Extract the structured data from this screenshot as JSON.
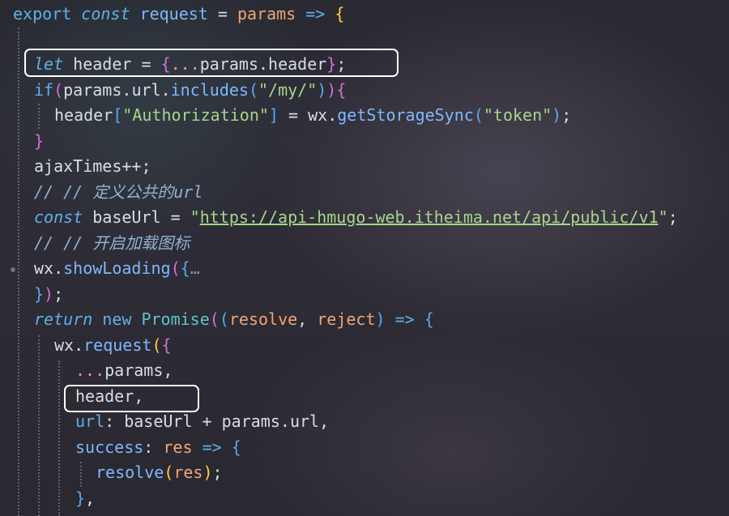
{
  "editor": {
    "lines": [
      {
        "tokens": [
          {
            "t": "export ",
            "c": "kw"
          },
          {
            "t": "const ",
            "c": "kwi"
          },
          {
            "t": "request ",
            "c": "fn"
          },
          {
            "t": "= ",
            "c": "pun"
          },
          {
            "t": "params ",
            "c": "param"
          },
          {
            "t": "=> ",
            "c": "kw"
          },
          {
            "t": "{",
            "c": "b1"
          }
        ]
      },
      {
        "tokens": []
      },
      {
        "tokens": [
          {
            "t": "let ",
            "c": "kwi"
          },
          {
            "t": "header ",
            "c": "prop"
          },
          {
            "t": "= ",
            "c": "pun"
          },
          {
            "t": "{",
            "c": "b2"
          },
          {
            "t": "...",
            "c": "op"
          },
          {
            "t": "params",
            "c": "prop"
          },
          {
            "t": ".",
            "c": "pun"
          },
          {
            "t": "header",
            "c": "prop"
          },
          {
            "t": "}",
            "c": "b2"
          },
          {
            "t": ";",
            "c": "pun"
          }
        ]
      },
      {
        "tokens": [
          {
            "t": "if",
            "c": "kw"
          },
          {
            "t": "(",
            "c": "b2"
          },
          {
            "t": "params",
            "c": "prop"
          },
          {
            "t": ".",
            "c": "pun"
          },
          {
            "t": "url",
            "c": "prop"
          },
          {
            "t": ".",
            "c": "pun"
          },
          {
            "t": "includes",
            "c": "fn"
          },
          {
            "t": "(",
            "c": "b3"
          },
          {
            "t": "\"/my/\"",
            "c": "str"
          },
          {
            "t": ")",
            "c": "b3"
          },
          {
            "t": ")",
            "c": "b2"
          },
          {
            "t": "{",
            "c": "b2"
          }
        ]
      },
      {
        "tokens": [
          {
            "t": "header",
            "c": "prop"
          },
          {
            "t": "[",
            "c": "b3"
          },
          {
            "t": "\"Authorization\"",
            "c": "str"
          },
          {
            "t": "]",
            "c": "b3"
          },
          {
            "t": " = ",
            "c": "pun"
          },
          {
            "t": "wx",
            "c": "prop"
          },
          {
            "t": ".",
            "c": "pun"
          },
          {
            "t": "getStorageSync",
            "c": "fn"
          },
          {
            "t": "(",
            "c": "b3"
          },
          {
            "t": "\"token\"",
            "c": "str"
          },
          {
            "t": ")",
            "c": "b3"
          },
          {
            "t": ";",
            "c": "pun"
          }
        ]
      },
      {
        "tokens": [
          {
            "t": "}",
            "c": "b2"
          }
        ]
      },
      {
        "tokens": [
          {
            "t": "ajaxTimes",
            "c": "prop"
          },
          {
            "t": "++;",
            "c": "pun"
          }
        ]
      },
      {
        "tokens": [
          {
            "t": "// // 定义公共的url",
            "c": "cm"
          }
        ]
      },
      {
        "tokens": [
          {
            "t": "const ",
            "c": "kwi"
          },
          {
            "t": "baseUrl ",
            "c": "prop"
          },
          {
            "t": "= ",
            "c": "pun"
          },
          {
            "t": "\"",
            "c": "str"
          },
          {
            "t": "https://api-hmugo-web.itheima.net/api/public/v1",
            "c": "url"
          },
          {
            "t": "\"",
            "c": "str"
          },
          {
            "t": ";",
            "c": "pun"
          }
        ]
      },
      {
        "tokens": [
          {
            "t": "// // 开启加载图标",
            "c": "cm"
          }
        ]
      },
      {
        "tokens": [
          {
            "t": "wx",
            "c": "prop"
          },
          {
            "t": ".",
            "c": "pun"
          },
          {
            "t": "showLoading",
            "c": "fn"
          },
          {
            "t": "(",
            "c": "b2"
          },
          {
            "t": "{",
            "c": "b3"
          },
          {
            "t": "…",
            "c": "fold"
          }
        ]
      },
      {
        "tokens": [
          {
            "t": "}",
            "c": "b3"
          },
          {
            "t": ")",
            "c": "b2"
          },
          {
            "t": ";",
            "c": "pun"
          }
        ]
      },
      {
        "tokens": [
          {
            "t": "return ",
            "c": "kwi"
          },
          {
            "t": "new ",
            "c": "kw"
          },
          {
            "t": "Promise",
            "c": "cls"
          },
          {
            "t": "(",
            "c": "b2"
          },
          {
            "t": "(",
            "c": "b3"
          },
          {
            "t": "resolve",
            "c": "param"
          },
          {
            "t": ", ",
            "c": "pun"
          },
          {
            "t": "reject",
            "c": "param"
          },
          {
            "t": ")",
            "c": "b3"
          },
          {
            "t": " => ",
            "c": "kw"
          },
          {
            "t": "{",
            "c": "b3"
          }
        ]
      },
      {
        "tokens": [
          {
            "t": "wx",
            "c": "prop"
          },
          {
            "t": ".",
            "c": "pun"
          },
          {
            "t": "request",
            "c": "fn"
          },
          {
            "t": "(",
            "c": "b1"
          },
          {
            "t": "{",
            "c": "b2"
          }
        ]
      },
      {
        "tokens": [
          {
            "t": "...",
            "c": "op"
          },
          {
            "t": "params",
            "c": "prop"
          },
          {
            "t": ",",
            "c": "pun"
          }
        ]
      },
      {
        "tokens": [
          {
            "t": "header",
            "c": "prop"
          },
          {
            "t": ",",
            "c": "pun"
          }
        ]
      },
      {
        "tokens": [
          {
            "t": "url",
            "c": "kw"
          },
          {
            "t": ": ",
            "c": "pun"
          },
          {
            "t": "baseUrl ",
            "c": "prop"
          },
          {
            "t": "+ ",
            "c": "pun"
          },
          {
            "t": "params",
            "c": "prop"
          },
          {
            "t": ".",
            "c": "pun"
          },
          {
            "t": "url",
            "c": "prop"
          },
          {
            "t": ",",
            "c": "pun"
          }
        ]
      },
      {
        "tokens": [
          {
            "t": "success",
            "c": "fn"
          },
          {
            "t": ": ",
            "c": "pun"
          },
          {
            "t": "res ",
            "c": "param"
          },
          {
            "t": "=> ",
            "c": "kw"
          },
          {
            "t": "{",
            "c": "b3"
          }
        ]
      },
      {
        "tokens": [
          {
            "t": "resolve",
            "c": "fn"
          },
          {
            "t": "(",
            "c": "b1"
          },
          {
            "t": "res",
            "c": "param"
          },
          {
            "t": ")",
            "c": "b1"
          },
          {
            "t": ";",
            "c": "pun"
          }
        ]
      },
      {
        "tokens": [
          {
            "t": "}",
            "c": "b3"
          },
          {
            "t": ",",
            "c": "pun"
          }
        ]
      }
    ]
  },
  "colors": {
    "keyword": "#5fb0e8",
    "string": "#a8d58a",
    "function": "#7fb8ff",
    "parameter": "#f0a676",
    "comment": "#8fb3cf",
    "highlight_box": "#ffffff"
  }
}
